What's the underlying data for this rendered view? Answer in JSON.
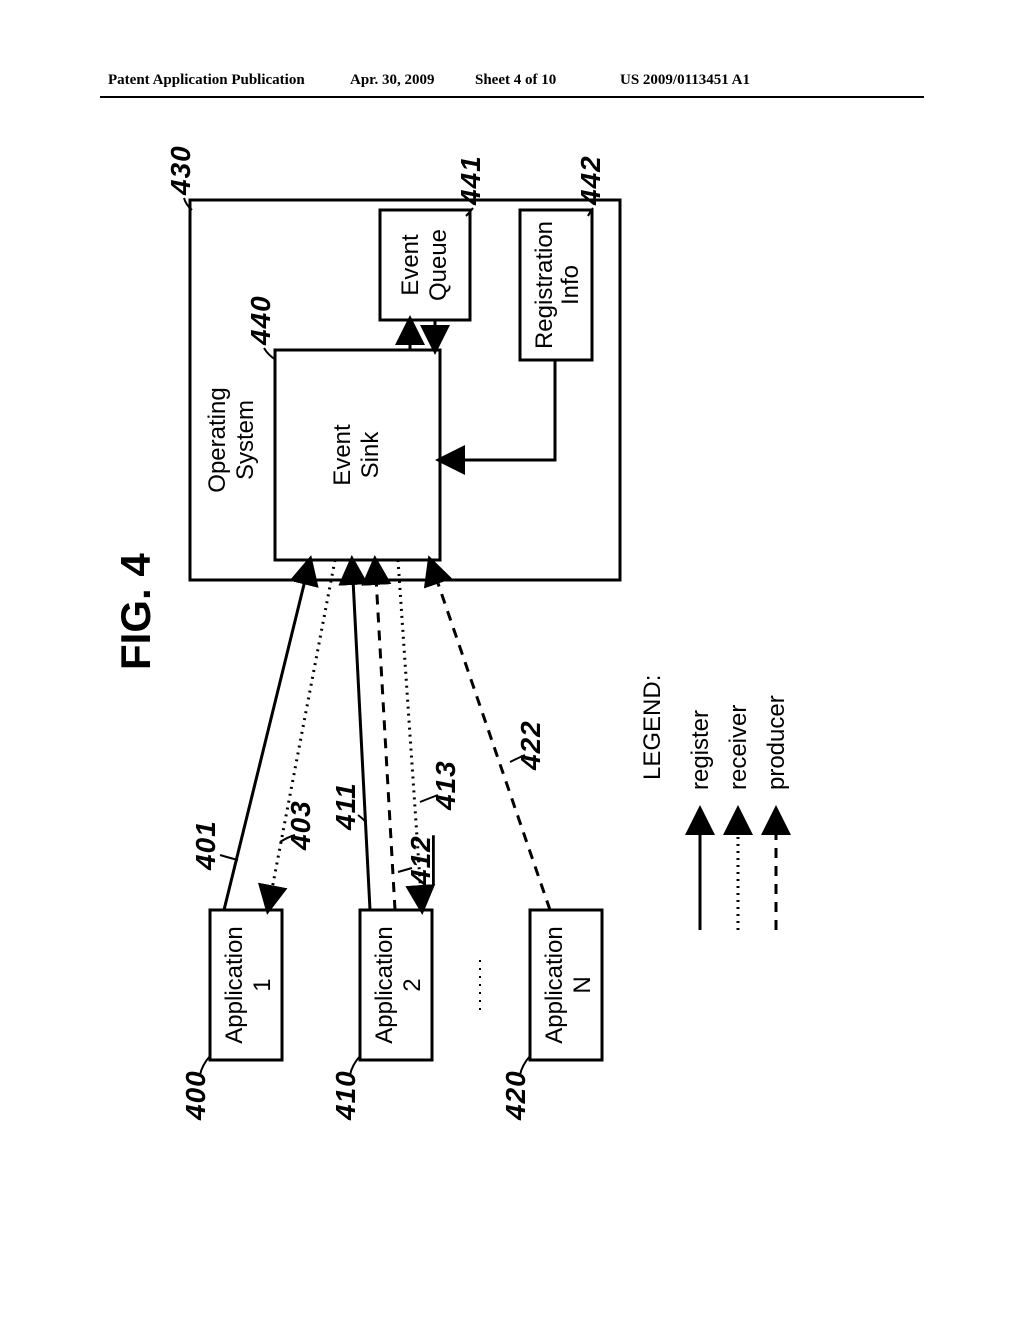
{
  "header": {
    "publication": "Patent Application Publication",
    "date": "Apr. 30, 2009",
    "sheet": "Sheet 4 of 10",
    "number": "US 2009/0113451 A1"
  },
  "figure": {
    "title": "FIG. 4",
    "boxes": {
      "app1": {
        "line1": "Application",
        "line2": "1",
        "ref": "400"
      },
      "app2": {
        "line1": "Application",
        "line2": "2",
        "ref": "410"
      },
      "appN": {
        "line1": "Application",
        "line2": "N",
        "ref": "420"
      },
      "os": {
        "label": "Operating System",
        "subline": "",
        "ref": "430"
      },
      "os_line1": "Operating",
      "os_line2": "System",
      "eventSink": {
        "line1": "Event",
        "line2": "Sink",
        "ref": "440"
      },
      "eventQueue": {
        "line1": "Event",
        "line2": "Queue",
        "ref": "441"
      },
      "regInfo": {
        "line1": "Registration",
        "line2": "Info",
        "ref": "442"
      }
    },
    "arrows": {
      "401": "401",
      "403": "403",
      "411": "411",
      "412": "412",
      "413": "413",
      "422": "422"
    },
    "legend": {
      "title": "LEGEND:",
      "register": "register",
      "receiver": "receiver",
      "producer": "producer"
    }
  }
}
